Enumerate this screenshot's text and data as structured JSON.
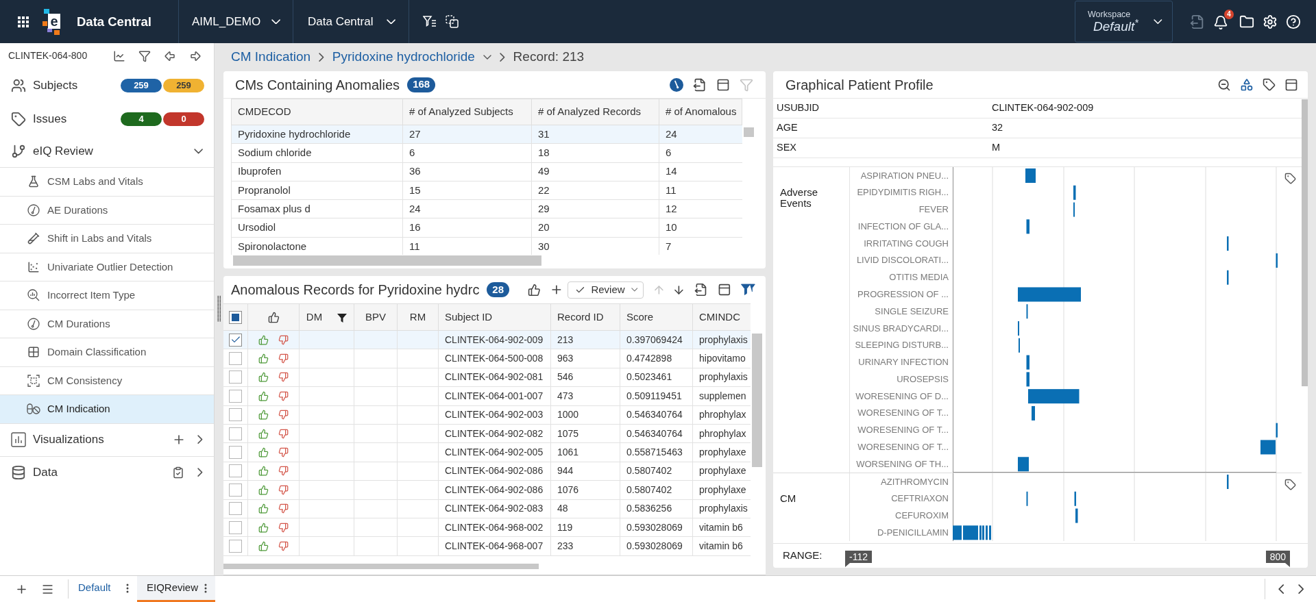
{
  "header": {
    "logo_letter": "e",
    "app_name": "Data Central",
    "project": "AIML_DEMO",
    "module": "Data Central",
    "workspace": {
      "label": "Workspace",
      "value": "Default$^{*}$"
    },
    "notifications": "4"
  },
  "sidebar": {
    "study": "CLINTEK-064-800",
    "subjects": {
      "label": "Subjects",
      "badges": [
        {
          "text": "259",
          "color": "#1f63a6"
        },
        {
          "text": "259",
          "color": "#f0b232"
        }
      ]
    },
    "issues": {
      "label": "Issues",
      "badges": [
        {
          "text": "4",
          "color": "#1e6a1e"
        },
        {
          "text": "0",
          "color": "#c2362b"
        }
      ]
    },
    "review": {
      "label": "eIQ Review",
      "expanded": true,
      "items": [
        {
          "label": "CSM Labs and Vitals",
          "selected": false
        },
        {
          "label": "AE Durations",
          "selected": false
        },
        {
          "label": "Shift in Labs and Vitals",
          "selected": false
        },
        {
          "label": "Univariate Outlier Detection",
          "selected": false
        },
        {
          "label": "Incorrect Item Type",
          "selected": false
        },
        {
          "label": "CM Durations",
          "selected": false
        },
        {
          "label": "Domain Classification",
          "selected": false
        },
        {
          "label": "CM Consistency",
          "selected": false
        },
        {
          "label": "CM Indication",
          "selected": true
        }
      ]
    },
    "visualizations": {
      "label": "Visualizations"
    },
    "data": {
      "label": "Data"
    }
  },
  "breadcrumb": [
    {
      "kind": "link",
      "label": "CM Indication"
    },
    {
      "kind": "dropdown",
      "label": "Pyridoxine hydrochloride"
    },
    {
      "kind": "current",
      "label": "Record: 213"
    }
  ],
  "cms": {
    "title": "CMs Containing Anomalies",
    "count": "168",
    "columns": [
      "CMDECOD",
      "# of Analyzed Subjects",
      "# of Analyzed Records",
      "# of Anomalous"
    ],
    "rows": [
      {
        "selected": true,
        "cells": [
          "Pyridoxine hydrochloride",
          "27",
          "31",
          "24"
        ]
      },
      {
        "selected": false,
        "cells": [
          "Sodium chloride",
          "6",
          "18",
          "6"
        ]
      },
      {
        "selected": false,
        "cells": [
          "Ibuprofen",
          "36",
          "49",
          "14"
        ]
      },
      {
        "selected": false,
        "cells": [
          "Propranolol",
          "15",
          "22",
          "11"
        ]
      },
      {
        "selected": false,
        "cells": [
          "Fosamax plus d",
          "24",
          "29",
          "12"
        ]
      },
      {
        "selected": false,
        "cells": [
          "Ursodiol",
          "16",
          "20",
          "10"
        ]
      },
      {
        "selected": false,
        "cells": [
          "Spironolactone",
          "11",
          "30",
          "7"
        ]
      }
    ]
  },
  "records": {
    "title": "Anomalous Records for Pyridoxine hydrc",
    "count": "28",
    "review_button": "Review",
    "select_all": {
      "checked": false,
      "partial": true
    },
    "columns": [
      {
        "kind": "vote",
        "filtered": false
      },
      {
        "kind": "flag",
        "label": "DM",
        "filtered": true
      },
      {
        "kind": "flag",
        "label": "BPV",
        "filtered": false
      },
      {
        "kind": "flag",
        "label": "RM",
        "filtered": false
      },
      {
        "kind": "text",
        "label": "Subject ID",
        "filtered": false
      },
      {
        "kind": "text",
        "label": "Record ID",
        "filtered": false
      },
      {
        "kind": "text",
        "label": "Score",
        "filtered": false
      },
      {
        "kind": "text",
        "label": "CMINDC",
        "filtered": false
      }
    ],
    "rows": [
      {
        "checked": true,
        "selected": true,
        "cells": [
          "CLINTEK-064-902-009",
          "213",
          "0.397069424",
          "prophylaxis"
        ]
      },
      {
        "checked": false,
        "selected": false,
        "cells": [
          "CLINTEK-064-500-008",
          "963",
          "0.4742898",
          "hipovitamo"
        ]
      },
      {
        "checked": false,
        "selected": false,
        "cells": [
          "CLINTEK-064-902-081",
          "546",
          "0.5023461",
          "prophylaxis"
        ]
      },
      {
        "checked": false,
        "selected": false,
        "cells": [
          "CLINTEK-064-001-007",
          "473",
          "0.509119451",
          "supplemen"
        ]
      },
      {
        "checked": false,
        "selected": false,
        "cells": [
          "CLINTEK-064-902-003",
          "1000",
          "0.546340764",
          "phrophylax"
        ]
      },
      {
        "checked": false,
        "selected": false,
        "cells": [
          "CLINTEK-064-902-082",
          "1075",
          "0.546340764",
          "phrophylax"
        ]
      },
      {
        "checked": false,
        "selected": false,
        "cells": [
          "CLINTEK-064-902-005",
          "1061",
          "0.558715463",
          "prophylaxe"
        ]
      },
      {
        "checked": false,
        "selected": false,
        "cells": [
          "CLINTEK-064-902-086",
          "944",
          "0.5807402",
          "prophylaxe"
        ]
      },
      {
        "checked": false,
        "selected": false,
        "cells": [
          "CLINTEK-064-902-086",
          "1076",
          "0.5807402",
          "prophylaxe"
        ]
      },
      {
        "checked": false,
        "selected": false,
        "cells": [
          "CLINTEK-064-902-083",
          "48",
          "0.5836256",
          "prophylaxis"
        ]
      },
      {
        "checked": false,
        "selected": false,
        "cells": [
          "CLINTEK-064-968-002",
          "119",
          "0.593028069",
          "vitamin b6"
        ]
      },
      {
        "checked": false,
        "selected": false,
        "cells": [
          "CLINTEK-064-968-007",
          "233",
          "0.593028069",
          "vitamin b6"
        ]
      }
    ]
  },
  "profile": {
    "title": "Graphical Patient Profile",
    "fields": [
      {
        "label": "USUBJID",
        "value": "CLINTEK-064-902-009"
      },
      {
        "label": "AGE",
        "value": "32"
      },
      {
        "label": "SEX",
        "value": "M"
      }
    ],
    "sections": [
      {
        "kind": "events",
        "label": "Adverse Events",
        "items": [
          "ASPIRATION PNEU...",
          "EPIDYDIMITIS RIGH...",
          "FEVER",
          "INFECTION OF GLA...",
          "IRRITATING COUGH",
          "LIVID DISCOLORATI...",
          "OTITIS MEDIA",
          "PROGRESSION OF ...",
          "SINGLE SEIZURE",
          "SINUS BRADYCARDI...",
          "SLEEPING DISTURB...",
          "URINARY INFECTION",
          "UROSEPSIS",
          "WORESENING OF D...",
          "WORESENING OF T...",
          "WORESENING OF T...",
          "WORESENING OF T...",
          "WORSENING OF TH..."
        ]
      },
      {
        "kind": "medications",
        "label": "CM",
        "items": [
          "AZITHROMYCIN",
          "CEFTRIAXON",
          "CEFUROXIM",
          "D-PENICILLAMIN"
        ]
      }
    ],
    "range": {
      "label": "RANGE:",
      "values": [
        "-112",
        "800"
      ]
    }
  },
  "bottom_bar": {
    "tabs": [
      {
        "label": "Default",
        "selected": false
      },
      {
        "label": "EIQReview",
        "selected": true
      }
    ]
  }
}
